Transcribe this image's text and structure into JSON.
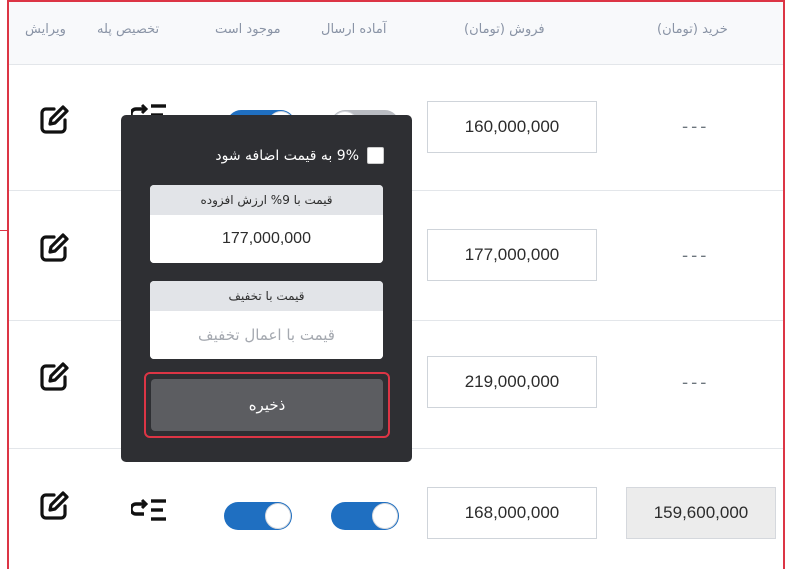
{
  "header": {
    "edit": "ویرایش",
    "tier_pricing": "تخصیص پله",
    "available": "موجود است",
    "ready_to_ship": "آماده ارسال",
    "sale_price": "فروش (تومان)",
    "purchase_price": "خرید (تومان)"
  },
  "rows": [
    {
      "sale": "160,000,000",
      "purchase": "---",
      "available_on": true,
      "ready_on": false
    },
    {
      "sale": "177,000,000",
      "purchase": "---"
    },
    {
      "sale": "219,000,000",
      "purchase": "---"
    },
    {
      "sale": "168,000,000",
      "purchase": "159,600,000",
      "available_on": true,
      "ready_on": true
    }
  ],
  "popover": {
    "vat_label": "9% به قیمت اضافه شود",
    "vat_checked": false,
    "vat_price_title": "قیمت با 9% ارزش افزوده",
    "vat_price_value": "177,000,000",
    "discount_title": "قیمت با تخفیف",
    "discount_placeholder": "قیمت با اعمال تخفیف",
    "save_label": "ذخیره"
  },
  "colors": {
    "toggle_on": "#1f6fc1",
    "toggle_off": "#b9bcc2",
    "highlight_border": "#dc3545",
    "popover_bg": "#2e2f33"
  }
}
